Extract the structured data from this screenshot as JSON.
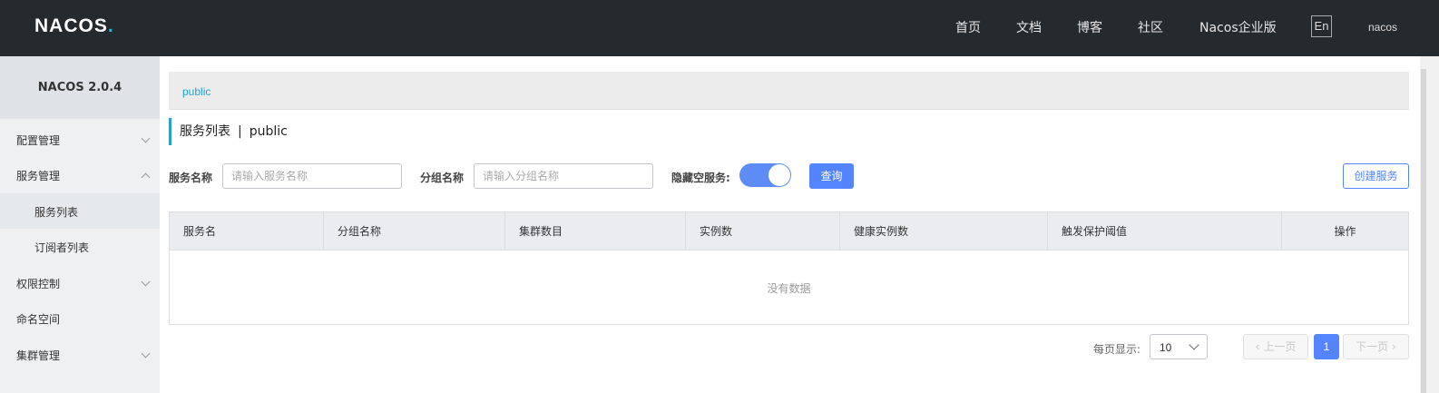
{
  "header": {
    "logo": "NACOS",
    "logo_dot": ".",
    "nav": [
      "首页",
      "文档",
      "博客",
      "社区",
      "Nacos企业版"
    ],
    "lang_button": "En",
    "user": "nacos"
  },
  "sidebar": {
    "title": "NACOS 2.0.4",
    "items": [
      {
        "label": "配置管理"
      },
      {
        "label": "服务管理"
      },
      {
        "label": "服务列表"
      },
      {
        "label": "订阅者列表"
      },
      {
        "label": "权限控制"
      },
      {
        "label": "命名空间"
      },
      {
        "label": "集群管理"
      }
    ]
  },
  "breadcrumb": {
    "namespace": "public"
  },
  "page": {
    "title": "服务列表",
    "separator": "|",
    "namespace": "public"
  },
  "filters": {
    "service_name_label": "服务名称",
    "service_name_placeholder": "请输入服务名称",
    "group_name_label": "分组名称",
    "group_name_placeholder": "请输入分组名称",
    "hide_empty_label": "隐藏空服务:",
    "hide_empty_on": true,
    "query_button": "查询",
    "create_button": "创建服务"
  },
  "table": {
    "columns": [
      "服务名",
      "分组名称",
      "集群数目",
      "实例数",
      "健康实例数",
      "触发保护阈值",
      "操作"
    ],
    "rows": [],
    "empty_text": "没有数据"
  },
  "pagination": {
    "page_size_label": "每页显示:",
    "page_size": "10",
    "prev_label": "上一页",
    "next_label": "下一页",
    "current_page": "1"
  },
  "colors": {
    "topbar": "#252a2f",
    "primary": "#5584ff",
    "accent": "#2a9fd6"
  }
}
